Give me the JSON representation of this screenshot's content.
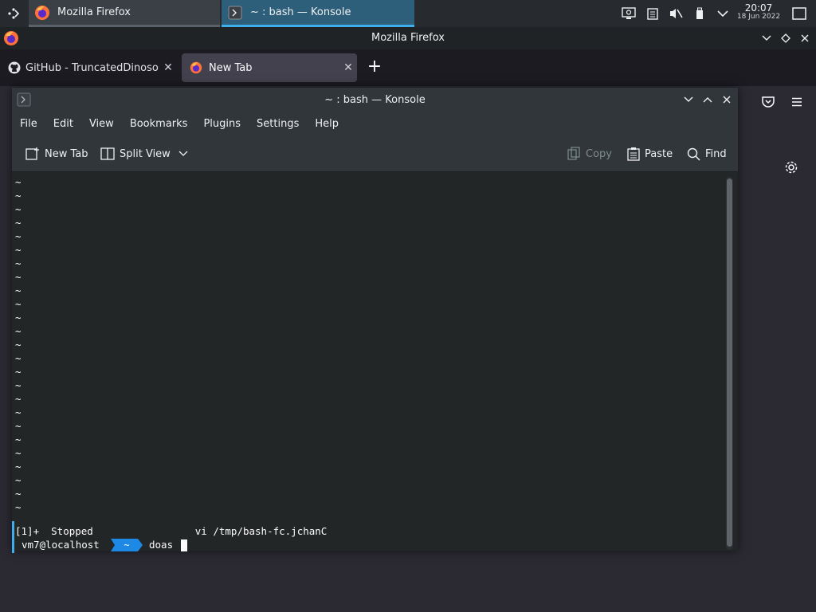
{
  "panel": {
    "tasks": [
      {
        "label": "Mozilla Firefox"
      },
      {
        "label": "~ : bash — Konsole"
      }
    ],
    "clock": {
      "time": "20:07",
      "date": "18 Jun 2022"
    }
  },
  "firefox": {
    "window_title": "Mozilla Firefox",
    "tabs": [
      {
        "label": "GitHub - TruncatedDinosour"
      },
      {
        "label": "New Tab"
      }
    ]
  },
  "konsole": {
    "window_title": "~ : bash — Konsole",
    "menu": [
      "File",
      "Edit",
      "View",
      "Bookmarks",
      "Plugins",
      "Settings",
      "Help"
    ],
    "toolbar": {
      "new_tab": "New Tab",
      "split_view": "Split View",
      "copy": "Copy",
      "paste": "Paste",
      "find": "Find"
    },
    "terminal": {
      "tilde_char": "~",
      "job_line": "[1]+  Stopped                 vi /tmp/bash-fc.jchanC",
      "host": "vm7@localhost",
      "dir": "~",
      "command": "doas"
    }
  },
  "colors": {
    "accent": "#3daee9",
    "panel_bg": "#272b30",
    "terminal_bg": "#232627",
    "prompt_pill": "#1e88e5"
  }
}
